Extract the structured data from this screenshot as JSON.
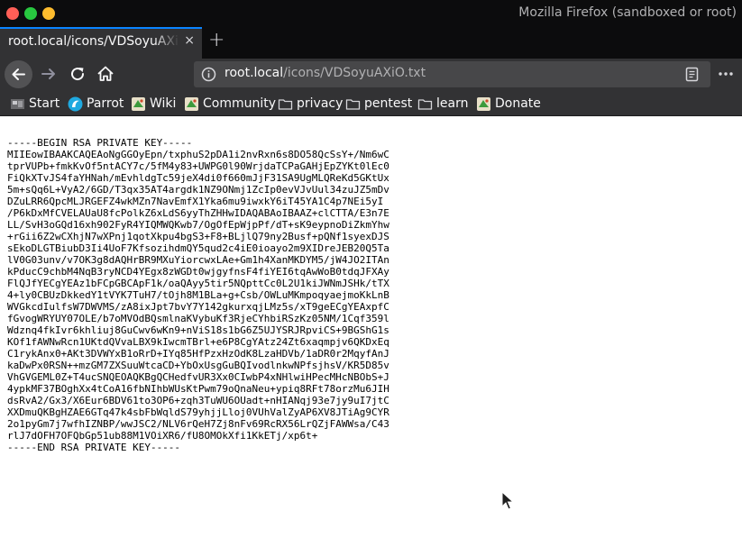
{
  "window": {
    "title": "Mozilla Firefox (sandboxed or root)"
  },
  "tab": {
    "title": "root.local/icons/VDSoyuAXiO.txt",
    "close": "×"
  },
  "new_tab": "+",
  "url": {
    "host": "root.local",
    "path": "/icons/VDSoyuAXiO.txt"
  },
  "bookmarks": {
    "start": "Start",
    "parrot": "Parrot",
    "wiki": "Wiki",
    "community": "Community",
    "privacy": "privacy",
    "pentest": "pentest",
    "learn": "learn",
    "donate": "Donate"
  },
  "content": {
    "lines": [
      "-----BEGIN RSA PRIVATE KEY-----",
      "MIIEowIBAAKCAQEAoNgGGOyEpn/txphuS2pDA1i2nvRxn6s8DO58QcSsY+/Nm6wC",
      "tprVUPb+fmkKvOf5ntACY7c/5fM4y83+UWPG0l90WrjdaTCPaGAHjEpZYKt0lEc0",
      "FiQkXTvJS4faYHNah/mEvhldgTc59jeX4di0f660mJjF31SA9UgMLQReKd5GKtUx",
      "5m+sQq6L+VyA2/6GD/T3qx35AT4argdk1NZ9ONmj1ZcIp0evVJvUul34zuJZ5mDv",
      "DZuLRR6QpcMLJRGEFZ4wkMZn7NavEmfX1Yka6mu9iwxkY6iT45YA1C4p7NEi5yI",
      "/P6kDxMfCVELAUaU8fcPolkZ6xLdS6yyThZHHwIDAQABAoIBAAZ+clCTTA/E3n7E",
      "LL/SvH3oGQd16xh902FyR4YIQMWQKwb7/OgOfEpWjpPf/dT+sK9eypnoDiZkmYhw",
      "+rGii6Z2wCXhjN7wXPnj1qotXkpu4bgS3+F8+BLjlQ79ny2Busf+pQNf1syexDJS",
      "sEkoDLGTBiubD3Ii4UoF7KfsozihdmQY5qud2c4iE0ioayo2m9XIDreJEB20Q5Ta",
      "lV0G03unv/v7OK3g8dAQHrBR9MXuYiorcwxLAe+Gm1h4XanMKDYM5/jW4JO2ITAn",
      "kPducC9chbM4NqB3ryNCD4YEgx8zWGDt0wjgyfnsF4fiYEI6tqAwWoB0tdqJFXAy",
      "FlQJfYECgYEAz1bFCpGBCApF1k/oaQAyy5tir5NQpttCc0L2U1kiJWNmJSHk/tTX",
      "4+ly0CBUzDkkedY1tVYK7TuH7/tOjh8M1BLa+g+Csb/OWLuMKmpoqyaejmoKkLnB",
      "WVGkcdIulfsW7DWVMS/zA8ixJpt7bvY7Y142gkurxqjLMz5s/xT9geECgYEAxpfC",
      "fGvogWRYUY07OLE/b7oMVOdBQsmlnaKVybuKf3RjeCYhbiRSzKz05NM/1Cqf359l",
      "Wdznq4fkIvr6khliuj8GuCwv6wKn9+nViS18s1bG6Z5UJYSRJRpviCS+9BGShG1s",
      "KOf1fAWNwRcn1UKtdQVvaLBX9kIwcmTBrl+e6P8CgYAtz24Zt6xaqmpjv6QKDxEq",
      "C1rykAnx0+AKt3DVWYxB1oRrD+IYq85HfPzxHzOdK8LzaHDVb/1aDR0r2MqyfAnJ",
      "kaDwPx0RSN++mzGM7ZXSuuWtcaCD+YbOxUsgGuBQIvodlnkwNPfsjhsV/KR5D85v",
      "VhGVGEML0Z+T4ucSNQEOAQKBgQCHedfvUR3Xx0CIwbP4xNHlwiHPecMHcNBObS+J",
      "4ypkMF37BOghXx4tCoA16fbNIhbWUsKtPwm79oQnaNeu+ypiq8RFt78orzMu6JIH",
      "dsRvA2/Gx3/X6Eur6BDV61to3OP6+zqh3TuWU6OUadt+nHIANqj93e7jy9uI7jtC",
      "XXDmuQKBgHZAE6GTq47k4sbFbWqldS79yhjjLloj0VUhValZyAP6XV8JTiAg9CYR",
      "2o1pyGm7j7wfhIZNBP/wwJSC2/NLV6rQeH7Zj8nFv69RcRX56LrQZjFAWWsa/C43",
      "rlJ7dOFH7OFQbGp51ub88M1VOiXR6/fU8OMOkXfi1KkETj/xp6t+",
      "-----END RSA PRIVATE KEY-----"
    ]
  }
}
